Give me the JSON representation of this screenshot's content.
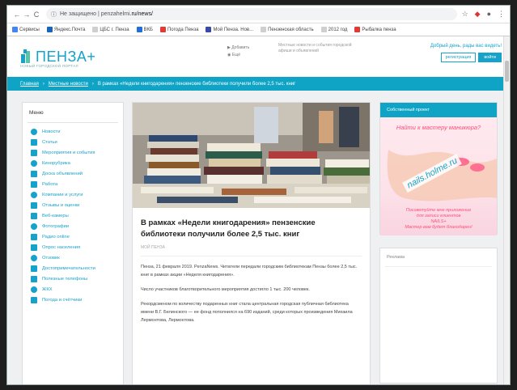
{
  "browser": {
    "url_host": "Не защищено | penzahelmi",
    "url_path": ".ru/news/",
    "bookmarks": [
      {
        "label": "Сервисы",
        "color": "#4285f4"
      },
      {
        "label": "Яндекс.Почта",
        "color": "#1565c0"
      },
      {
        "label": "ЦБС г. Пенза",
        "color": "#cfcfcf"
      },
      {
        "label": "ВКБ",
        "color": "#1f6fd6"
      },
      {
        "label": "Погода Пенза",
        "color": "#e53935"
      },
      {
        "label": "Мой Пенза. Нов...",
        "color": "#3949ab"
      },
      {
        "label": "Пензенская область",
        "color": "#cfcfcf"
      },
      {
        "label": "2012 год",
        "color": "#cfcfcf"
      },
      {
        "label": "Рыбалка пенза",
        "color": "#e53935"
      }
    ]
  },
  "header": {
    "logo_text": "ПЕНЗА+",
    "logo_sub": "НОВЫЙ ГОРОДСКОЙ ПОРТАЛ",
    "mid_links": [
      "Добавить",
      "Ещё"
    ],
    "description": "Местные новости и события городской афиши и объявлений",
    "welcome": "Добрый день, рады вас видеть!",
    "register_label": "регистрация",
    "login_label": "войти"
  },
  "breadcrumbs": {
    "home": "Главная",
    "section": "Местные новости",
    "current": "В рамках «Недели книгодарения» пензенские библиотеки получили более 2,5 тыс. книг"
  },
  "sidebar": {
    "title": "Меню",
    "items": [
      {
        "label": "Новости",
        "icon": "rss-icon",
        "color": "#17a2c9"
      },
      {
        "label": "Статьи",
        "icon": "document-icon",
        "color": "#17a2c9"
      },
      {
        "label": "Мероприятия и события",
        "icon": "calendar-icon",
        "color": "#17a2c9"
      },
      {
        "label": "Кинорубрика",
        "icon": "film-icon",
        "color": "#17a2c9"
      },
      {
        "label": "Доска объявлений",
        "icon": "tag-icon",
        "color": "#17a2c9"
      },
      {
        "label": "Работа",
        "icon": "briefcase-icon",
        "color": "#17a2c9"
      },
      {
        "label": "Компании и услуги",
        "icon": "building-icon",
        "color": "#17a2c9"
      },
      {
        "label": "Отзывы и оценки",
        "icon": "star-icon",
        "color": "#17a2c9"
      },
      {
        "label": "Веб-камеры",
        "icon": "webcam-icon",
        "color": "#17a2c9"
      },
      {
        "label": "Фотографии",
        "icon": "photo-icon",
        "color": "#17a2c9"
      },
      {
        "label": "Радио online",
        "icon": "radio-icon",
        "color": "#17a2c9"
      },
      {
        "label": "Опрос населения",
        "icon": "chart-icon",
        "color": "#17a2c9"
      },
      {
        "label": "Отзовик",
        "icon": "comment-icon",
        "color": "#17a2c9"
      },
      {
        "label": "Достопримечательности",
        "icon": "landmark-icon",
        "color": "#17a2c9"
      },
      {
        "label": "Полезные телефоны",
        "icon": "phone-icon",
        "color": "#17a2c9"
      },
      {
        "label": "ЖКХ",
        "icon": "home-icon",
        "color": "#17a2c9"
      },
      {
        "label": "Погода и счётчики",
        "icon": "weather-icon",
        "color": "#17a2c9"
      }
    ]
  },
  "article": {
    "title": "В рамках «Недели книгодарения» пензенские библиотеки получили более 2,5 тыс. книг",
    "meta": "МОЙ ПЕНЗА",
    "paragraphs": [
      "Пенза, 21 февраля 2019. PenzaNews. Читатели передали городским библиотекам Пензы более 2,5 тыс. книг в рамках акции «Неделя книгодарения».",
      "Число участников благотворительного мероприятия достигло 1 тыс. 200 человек.",
      "Рекордсменом по количеству подаренных книг стала центральная городская публичная библиотека имени В.Г. Белинского — ее фонд пополнился на 690 изданий, среди которых произведения Михаила Лермонтова, Лермонтова."
    ]
  },
  "promo": {
    "title": "Собственный проект",
    "top": "Найти к мастеру маникюра?",
    "url": "nails.holme.ru",
    "bottom_lines": [
      "Посоветуйте мне приложение",
      "для записи клиентов",
      "NAILS+",
      "Мастер вам будет благодарен!"
    ]
  },
  "ad": {
    "title": "Реклама"
  }
}
